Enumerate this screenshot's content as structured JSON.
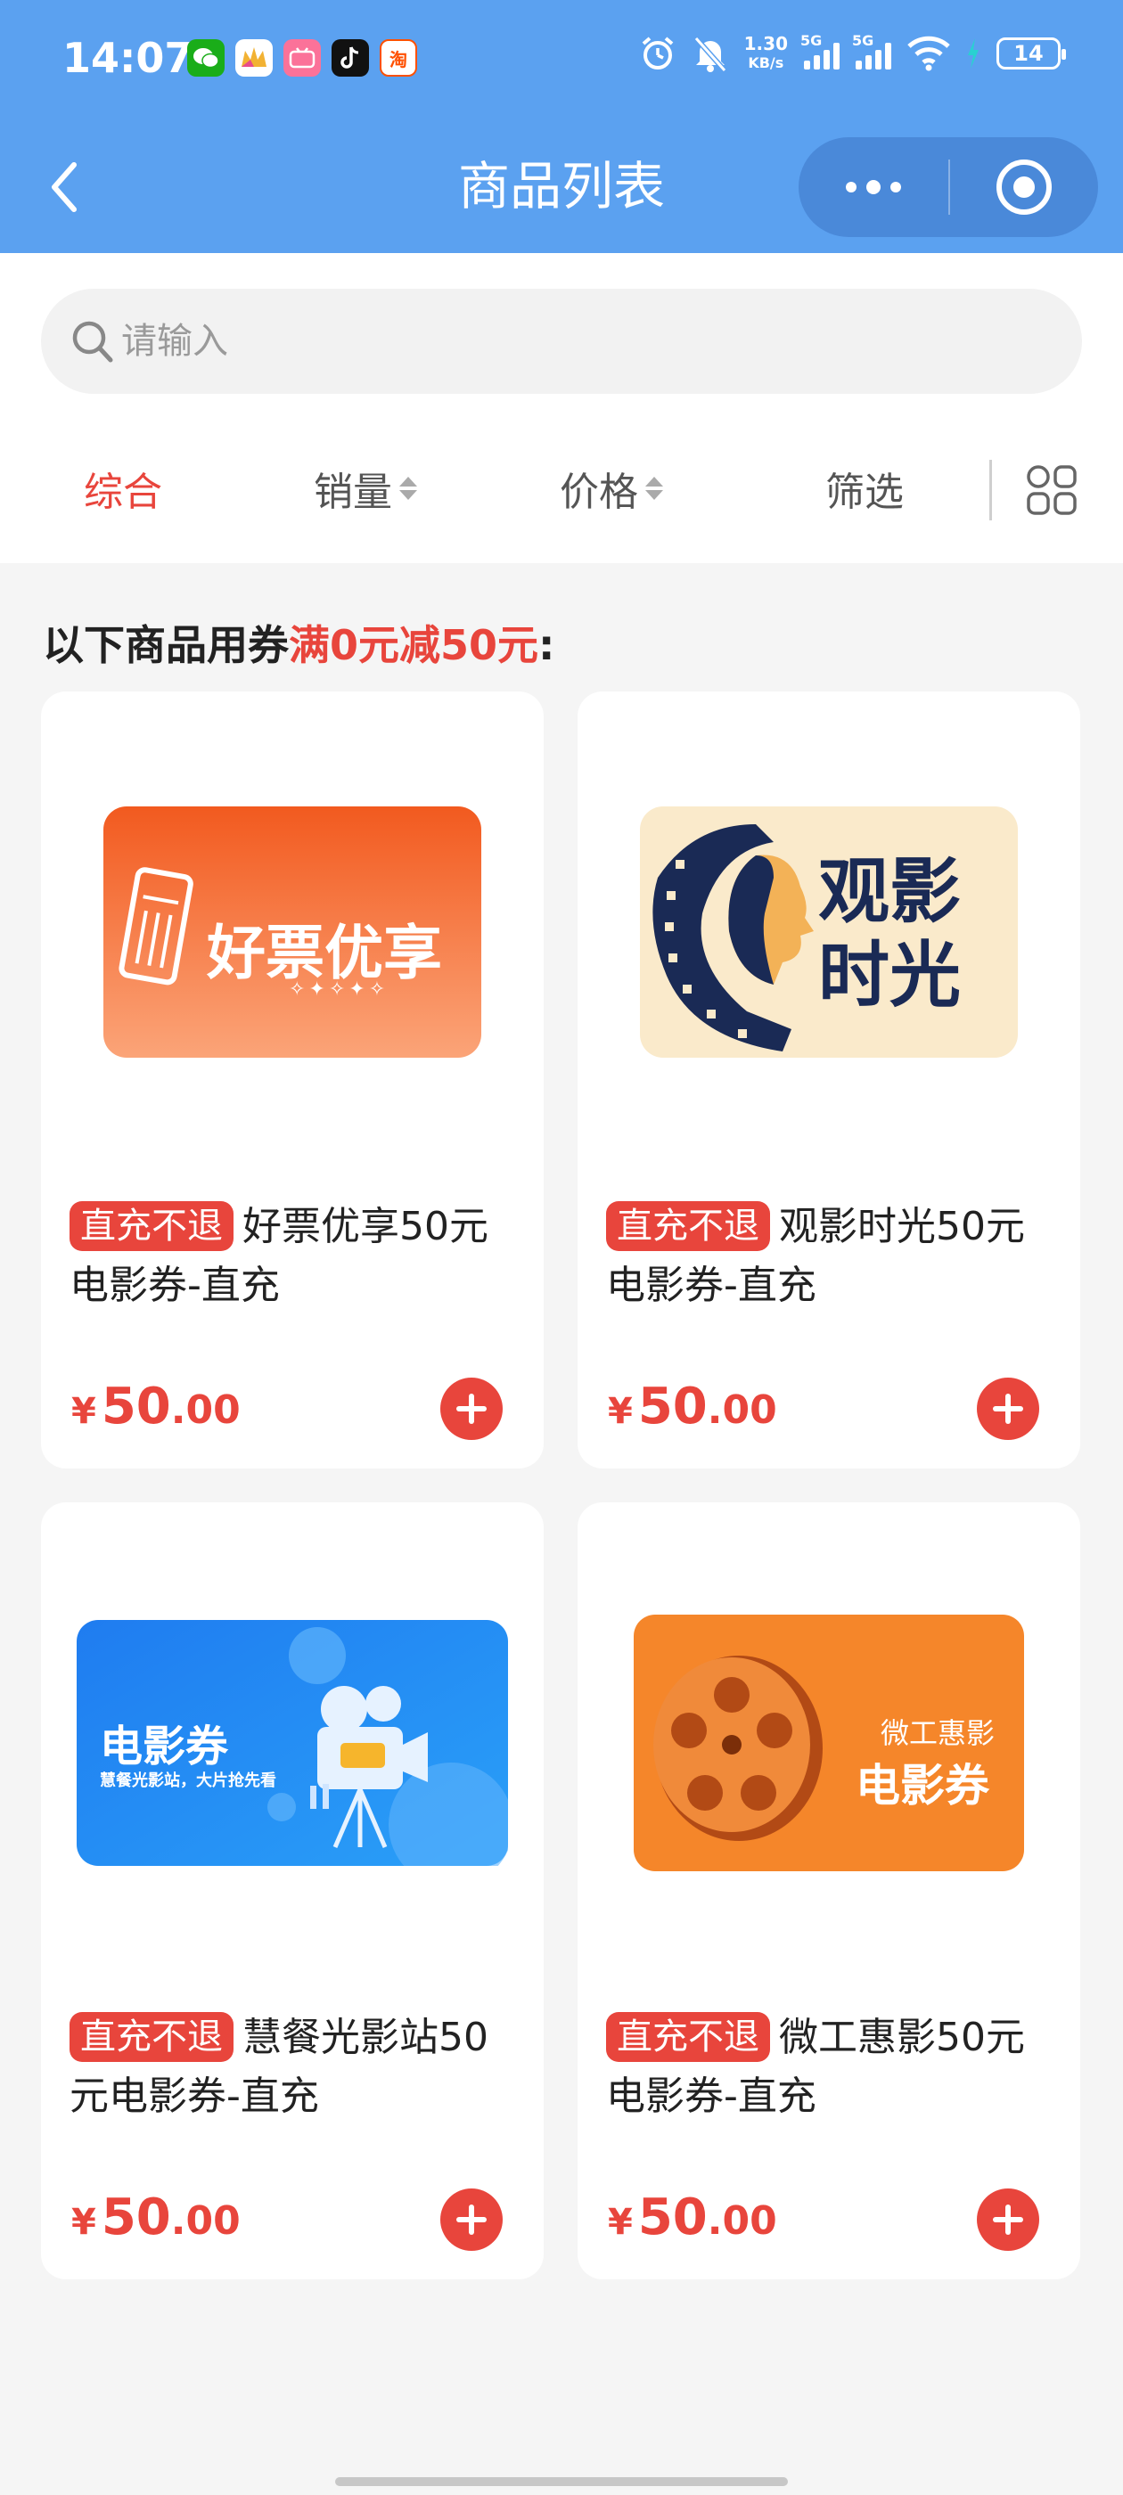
{
  "status_bar": {
    "time": "14:07",
    "app_icons": [
      "wechat-icon",
      "app-icon",
      "bilibili-icon",
      "tiktok-icon",
      "taobao-icon"
    ],
    "taobao_glyph": "淘",
    "net_speed_value": "1.30",
    "net_speed_unit": "KB/s",
    "signal_label": "5G",
    "battery": "14"
  },
  "nav": {
    "title": "商品列表"
  },
  "search": {
    "placeholder": "请输入"
  },
  "filters": {
    "items": [
      "综合",
      "销量",
      "价格",
      "筛选"
    ],
    "active": "综合"
  },
  "coupon_note": {
    "prefix": "以下商品用券",
    "highlight": "满0元减50元",
    "suffix": ":"
  },
  "products": [
    {
      "tag": "直充不退",
      "name": "好票优享50元电影券-直充",
      "price_symbol": "¥",
      "price_int": "50",
      "price_dec": ".00",
      "poster_text": "好票优享",
      "poster_sub": "✧✦✧✦✧"
    },
    {
      "tag": "直充不退",
      "name": "观影时光50元电影券-直充",
      "price_symbol": "¥",
      "price_int": "50",
      "price_dec": ".00",
      "poster_text_1": "观影",
      "poster_text_2": "时光"
    },
    {
      "tag": "直充不退",
      "name": "慧餐光影站50元电影券-直充",
      "price_symbol": "¥",
      "price_int": "50",
      "price_dec": ".00",
      "poster_text": "电影券",
      "poster_sub": "慧餐光影站，大片抢先看"
    },
    {
      "tag": "直充不退",
      "name": "微工惠影50元电影券-直充",
      "price_symbol": "¥",
      "price_int": "50",
      "price_dec": ".00",
      "poster_sub": "微工惠影",
      "poster_text": "电影券"
    }
  ],
  "colors": {
    "header": "#5ba1f0",
    "accent": "#e8453c",
    "background": "#f5f5f5"
  }
}
